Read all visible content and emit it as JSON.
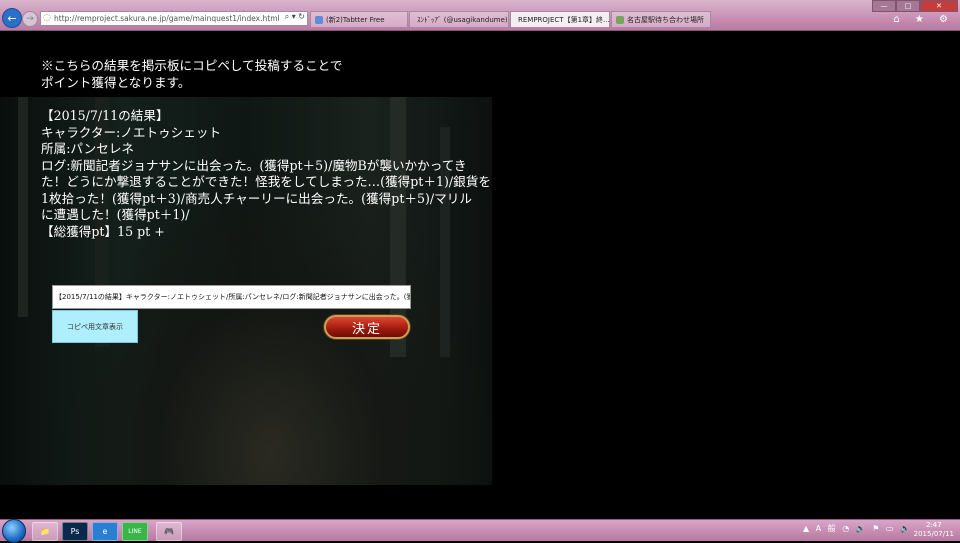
{
  "browser": {
    "back_glyph": "←",
    "forward_glyph": "→",
    "url": "http://remproject.sakura.ne.jp/game/mainquest1/index.html",
    "address_tools": "⌕ ▾ ↻",
    "tabs": [
      {
        "label": "(新2)Tabtter Free",
        "icon_color": "#5b8dd9"
      },
      {
        "label": "ｽﾝﾄﾞｯｱﾞ (@usagikandume)さ...",
        "icon_color": "#55acee"
      },
      {
        "label": "REMPROJECT【第1章】終...",
        "icon_color": "#c84b4b",
        "active": true
      },
      {
        "label": "名古屋駅待ち合わせ場所",
        "icon_color": "#7aa35b"
      }
    ],
    "tab_close": "✕",
    "window_buttons": {
      "minimize": "—",
      "maximize": "□",
      "close": "✕"
    },
    "toolbar_icons": "⌂ ★ ⚙"
  },
  "page": {
    "intro_lines": [
      "※こちらの結果を掲示板にコピペして投稿することで",
      "ポイント獲得となります。"
    ],
    "result_lines": [
      "【2015/7/11の結果】",
      "キャラクター:ノエトゥシェット",
      "所属:パンセレネ",
      "ログ:新聞記者ジョナサンに出会った。(獲得pt＋5)/魔物Bが襲いかかってき",
      "た！どうにか撃退することができた！怪我をしてしまった…(獲得pt＋1)/銀貨を",
      "1枚拾った！(獲得pt＋3)/商売人チャーリーに出会った。(獲得pt＋5)/マリル",
      "に遭遇した！(獲得pt＋1)/",
      "【総獲得pt】15 pt +"
    ],
    "copy_field_value": "【2015/7/11の結果】キャラクター:ノエトゥシェット/所属:パンセレネ/ログ:新聞記者ジョナサンに出会った。(獲得pt＋5)/魔物Bが襲いかか",
    "copy_button_label": "コピペ用文章表示",
    "decide_button_label": "決定"
  },
  "taskbar": {
    "apps": [
      "📁",
      "Ps",
      "e",
      "LINE",
      "🎮"
    ],
    "tray_text": "▲ A 般 ◔ 🔊 ⚑ ▭ 🔈",
    "time": "2:47",
    "date": "2015/07/11"
  }
}
